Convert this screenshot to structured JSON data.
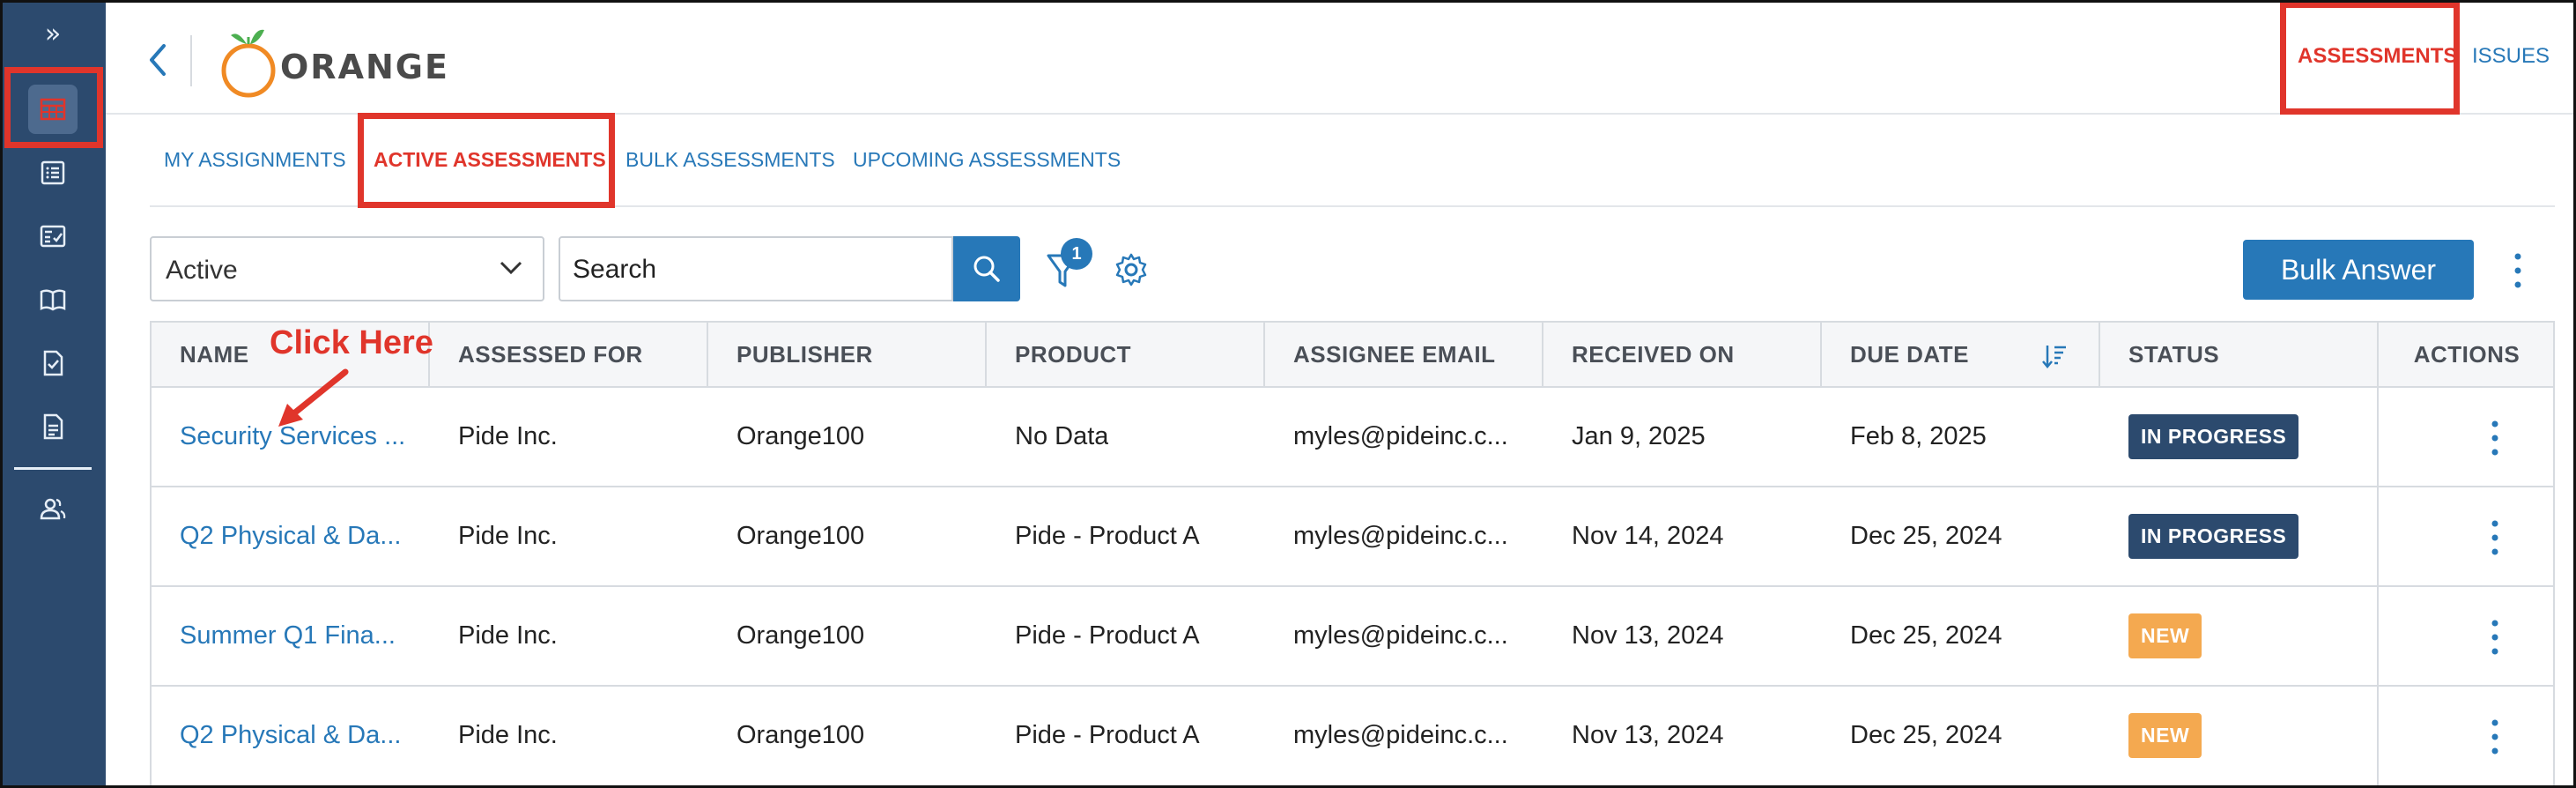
{
  "sidebar": {
    "expand_glyph": "»",
    "items": [
      {
        "icon": "table-grid-icon",
        "active": true
      },
      {
        "icon": "list-icon"
      },
      {
        "icon": "checklist-icon"
      },
      {
        "icon": "book-icon"
      },
      {
        "icon": "document-check-icon"
      },
      {
        "icon": "document-icon"
      },
      {
        "icon": "users-icon"
      }
    ]
  },
  "header": {
    "logo_text": "ORANGE",
    "nav": {
      "assessments": "ASSESSMENTS",
      "issues": "ISSUES"
    }
  },
  "tabs": [
    {
      "label": "MY ASSIGNMENTS",
      "active": false
    },
    {
      "label": "ACTIVE ASSESSMENTS",
      "active": true
    },
    {
      "label": "BULK ASSESSMENTS",
      "active": false
    },
    {
      "label": "UPCOMING ASSESSMENTS",
      "active": false
    }
  ],
  "toolbar": {
    "status_filter": "Active",
    "search_placeholder": "Search",
    "filter_count": "1",
    "bulk_answer_label": "Bulk Answer"
  },
  "table": {
    "columns": [
      "NAME",
      "ASSESSED FOR",
      "PUBLISHER",
      "PRODUCT",
      "ASSIGNEE EMAIL",
      "RECEIVED ON",
      "DUE DATE",
      "STATUS",
      "ACTIONS"
    ],
    "rows": [
      {
        "name": "Security Services ...",
        "assessed_for": "Pide Inc.",
        "publisher": "Orange100",
        "product": "No Data",
        "email": "myles@pideinc.c...",
        "received": "Jan 9, 2025",
        "due": "Feb 8, 2025",
        "status": "IN PROGRESS"
      },
      {
        "name": "Q2 Physical & Da...",
        "assessed_for": "Pide Inc.",
        "publisher": "Orange100",
        "product": "Pide - Product A",
        "email": "myles@pideinc.c...",
        "received": "Nov 14, 2024",
        "due": "Dec 25, 2024",
        "status": "IN PROGRESS"
      },
      {
        "name": "Summer Q1 Fina...",
        "assessed_for": "Pide Inc.",
        "publisher": "Orange100",
        "product": "Pide - Product A",
        "email": "myles@pideinc.c...",
        "received": "Nov 13, 2024",
        "due": "Dec 25, 2024",
        "status": "NEW"
      },
      {
        "name": "Q2 Physical & Da...",
        "assessed_for": "Pide Inc.",
        "publisher": "Orange100",
        "product": "Pide - Product A",
        "email": "myles@pideinc.c...",
        "received": "Nov 13, 2024",
        "due": "Dec 25, 2024",
        "status": "NEW"
      }
    ]
  },
  "annotation": {
    "text": "Click Here"
  },
  "colors": {
    "sidebar": "#2c4a6e",
    "accent_blue": "#2778b8",
    "highlight_red": "#e0352b",
    "badge_in_progress": "#2c4a6e",
    "badge_new": "#f4a950",
    "orange_logo": "#f08a24",
    "leaf_green": "#4caf50"
  }
}
